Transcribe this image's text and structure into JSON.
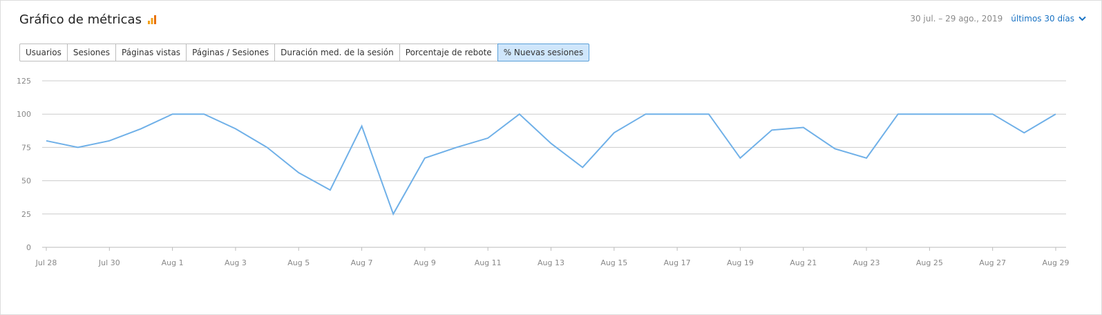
{
  "header": {
    "title": "Gráfico de métricas",
    "date_range": "30 jul. – 29 ago., 2019",
    "period_label": "últimos 30 días"
  },
  "tabs": [
    {
      "label": "Usuarios",
      "active": false
    },
    {
      "label": "Sesiones",
      "active": false
    },
    {
      "label": "Páginas vistas",
      "active": false
    },
    {
      "label": "Páginas / Sesiones",
      "active": false
    },
    {
      "label": "Duración med. de la sesión",
      "active": false
    },
    {
      "label": "Porcentaje de rebote",
      "active": false
    },
    {
      "label": "% Nuevas sesiones",
      "active": true
    }
  ],
  "colors": {
    "line": "#6fb0e8",
    "grid": "#cccccc",
    "axis_text": "#888888",
    "accent": "#1a73c4",
    "icon_orange": "#f4a11a"
  },
  "chart_data": {
    "type": "line",
    "x": [
      "Jul 28",
      "Jul 29",
      "Jul 30",
      "Jul 31",
      "Aug 1",
      "Aug 2",
      "Aug 3",
      "Aug 4",
      "Aug 5",
      "Aug 6",
      "Aug 7",
      "Aug 8",
      "Aug 9",
      "Aug 10",
      "Aug 11",
      "Aug 12",
      "Aug 13",
      "Aug 14",
      "Aug 15",
      "Aug 16",
      "Aug 17",
      "Aug 18",
      "Aug 19",
      "Aug 20",
      "Aug 21",
      "Aug 22",
      "Aug 23",
      "Aug 24",
      "Aug 25",
      "Aug 26",
      "Aug 27",
      "Aug 28",
      "Aug 29"
    ],
    "x_tick_labels": [
      "Jul 28",
      "Jul 30",
      "Aug 1",
      "Aug 3",
      "Aug 5",
      "Aug 7",
      "Aug 9",
      "Aug 11",
      "Aug 13",
      "Aug 15",
      "Aug 17",
      "Aug 19",
      "Aug 21",
      "Aug 23",
      "Aug 25",
      "Aug 27",
      "Aug 29"
    ],
    "values": [
      80,
      75,
      80,
      89,
      100,
      100,
      89,
      75,
      56,
      43,
      91,
      25,
      67,
      75,
      82,
      100,
      78,
      60,
      86,
      100,
      100,
      100,
      67,
      88,
      90,
      74,
      67,
      100,
      100,
      100,
      100,
      86,
      100
    ],
    "ylim": [
      0,
      125
    ],
    "y_ticks": [
      0,
      25,
      50,
      75,
      100,
      125
    ],
    "grid": true,
    "title": "",
    "xlabel": "",
    "ylabel": ""
  }
}
